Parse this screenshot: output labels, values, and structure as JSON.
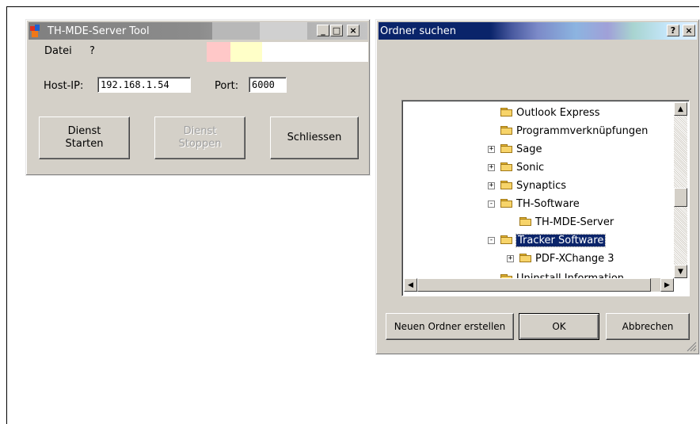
{
  "main_window": {
    "title": "TH-MDE-Server Tool",
    "menu": [
      "Datei",
      "?"
    ],
    "host_label": "Host-IP:",
    "host_value": "192.168.1.54",
    "port_label": "Port:",
    "port_value": "6000",
    "start_label": "Dienst\nStarten",
    "stop_label": "Dienst\nStoppen",
    "close_label": "Schliessen",
    "caption_min": "_",
    "caption_max": "□",
    "caption_close": "×"
  },
  "folder_dialog": {
    "title": "Ordner suchen",
    "caption_help": "?",
    "caption_close": "×",
    "tree_items": [
      {
        "label": "Outlook Express",
        "expander": ""
      },
      {
        "label": "Programmverknüpfungen",
        "expander": ""
      },
      {
        "label": "Sage",
        "expander": "+"
      },
      {
        "label": "Sonic",
        "expander": "+"
      },
      {
        "label": "Synaptics",
        "expander": "+"
      },
      {
        "label": "TH-Software",
        "expander": "-"
      },
      {
        "label": "TH-MDE-Server",
        "expander": ""
      },
      {
        "label": "Tracker Software",
        "expander": "-"
      },
      {
        "label": "PDF-XChange 3",
        "expander": "+"
      },
      {
        "label": "Uninstall Information",
        "expander": ""
      }
    ],
    "selected_item": "Tracker Software",
    "new_folder_label": "Neuen Ordner erstellen",
    "ok_label": "OK",
    "cancel_label": "Abbrechen"
  },
  "colors": {
    "selection": "#0a246a",
    "dialog_title": "#0a246a",
    "window_face": "#d4d0c8"
  }
}
